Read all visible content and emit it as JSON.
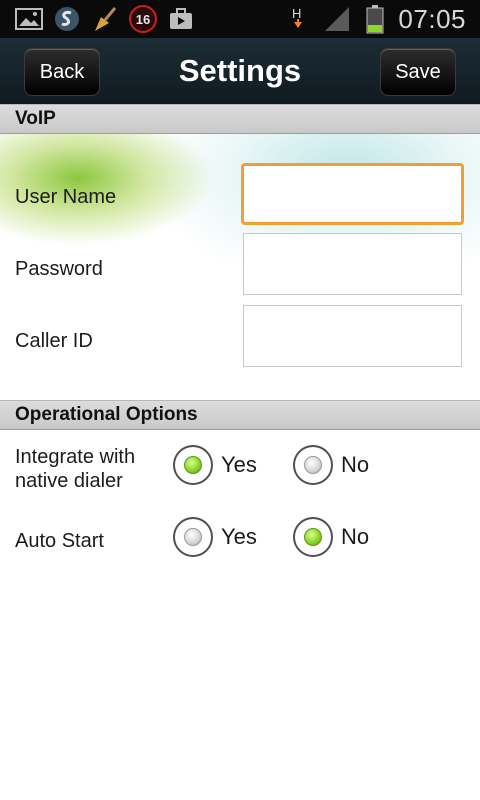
{
  "status_bar": {
    "notification_count": "16",
    "network_type": "H",
    "time": "07:05"
  },
  "header": {
    "back_label": "Back",
    "title": "Settings",
    "save_label": "Save"
  },
  "voip": {
    "section_title": "VoIP",
    "username": {
      "label": "User Name",
      "value": ""
    },
    "password": {
      "label": "Password",
      "value": ""
    },
    "caller_id": {
      "label": "Caller ID",
      "value": ""
    }
  },
  "operational": {
    "section_title": "Operational Options",
    "integrate": {
      "label_line1": "Integrate with",
      "label_line2": "native dialer",
      "yes_label": "Yes",
      "no_label": "No",
      "selected": "Yes"
    },
    "auto_start": {
      "label": "Auto Start",
      "yes_label": "Yes",
      "no_label": "No",
      "selected": "No"
    }
  },
  "colors": {
    "focus_border": "#f0a030",
    "radio_selected": "#8ed62a",
    "header_bg": "#1d2e36"
  }
}
